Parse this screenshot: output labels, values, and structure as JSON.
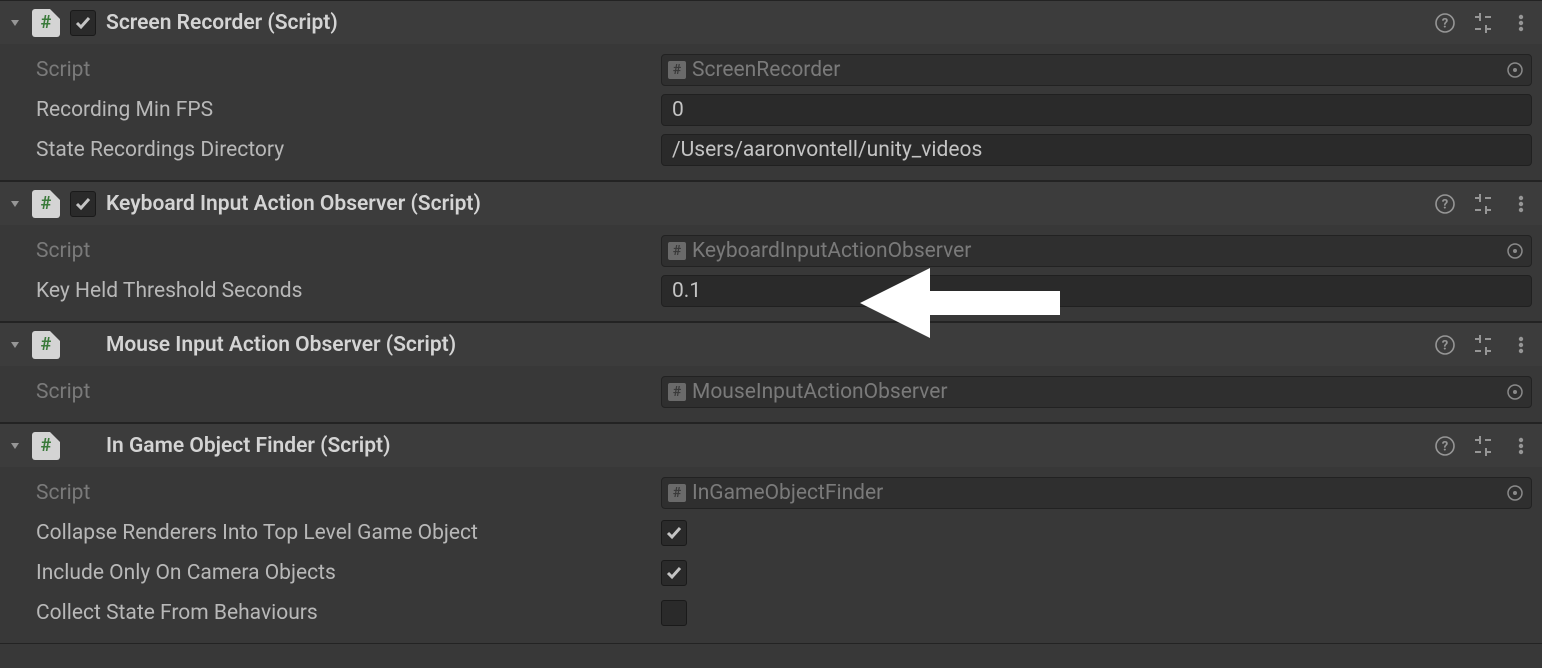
{
  "components": [
    {
      "title": "Screen Recorder (Script)",
      "has_enable_checkbox": true,
      "enabled": true,
      "script_label": "Script",
      "script_value": "ScreenRecorder",
      "fields": [
        {
          "label": "Recording Min FPS",
          "type": "text",
          "value": "0"
        },
        {
          "label": "State Recordings Directory",
          "type": "text",
          "value": "/Users/aaronvontell/unity_videos"
        }
      ]
    },
    {
      "title": "Keyboard Input Action Observer (Script)",
      "has_enable_checkbox": true,
      "enabled": true,
      "script_label": "Script",
      "script_value": "KeyboardInputActionObserver",
      "fields": [
        {
          "label": "Key Held Threshold Seconds",
          "type": "text",
          "value": "0.1"
        }
      ]
    },
    {
      "title": "Mouse Input Action Observer (Script)",
      "has_enable_checkbox": false,
      "enabled": true,
      "script_label": "Script",
      "script_value": "MouseInputActionObserver",
      "fields": []
    },
    {
      "title": "In Game Object Finder (Script)",
      "has_enable_checkbox": false,
      "enabled": true,
      "script_label": "Script",
      "script_value": "InGameObjectFinder",
      "fields": [
        {
          "label": "Collapse Renderers Into Top Level Game Object",
          "type": "checkbox",
          "checked": true
        },
        {
          "label": "Include Only On Camera Objects",
          "type": "checkbox",
          "checked": true
        },
        {
          "label": "Collect State From Behaviours",
          "type": "checkbox",
          "checked": false
        }
      ]
    }
  ]
}
